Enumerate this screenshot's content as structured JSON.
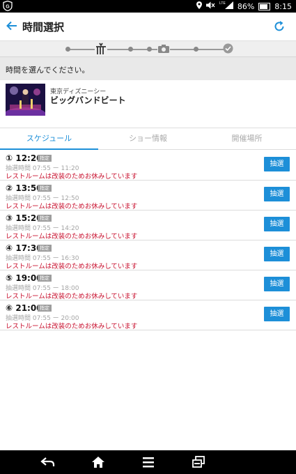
{
  "status_bar": {
    "battery": "86%",
    "time": "8:15",
    "network": "LTE"
  },
  "app_bar": {
    "title": "時間選択",
    "back_icon": "arrow-left-icon",
    "refresh_icon": "refresh-icon"
  },
  "notice": "時間を選んでください。",
  "show": {
    "location": "東京ディズニーシー",
    "name": "ビッグバンドビート"
  },
  "tabs": [
    {
      "label": "スケジュール",
      "active": true
    },
    {
      "label": "ショー情報",
      "active": false
    },
    {
      "label": "開催場所",
      "active": false
    }
  ],
  "schedule": [
    {
      "time": "① 12:20",
      "badge": "指定",
      "period": "抽選時間 07:55 ー 11:20",
      "warning": "レストルームは改装のためお休みしています",
      "button": "抽選"
    },
    {
      "time": "② 13:50",
      "badge": "指定",
      "period": "抽選時間 07:55 ー 12:50",
      "warning": "レストルームは改装のためお休みしています",
      "button": "抽選"
    },
    {
      "time": "③ 15:20",
      "badge": "指定",
      "period": "抽選時間 07:55 ー 14:20",
      "warning": "レストルームは改装のためお休みしています",
      "button": "抽選"
    },
    {
      "time": "④ 17:30",
      "badge": "指定",
      "period": "抽選時間 07:55 ー 16:30",
      "warning": "レストルームは改装のためお休みしています",
      "button": "抽選"
    },
    {
      "time": "⑤ 19:00",
      "badge": "指定",
      "period": "抽選時間 07:55 ー 18:00",
      "warning": "レストルームは改装のためお休みしています",
      "button": "抽選"
    },
    {
      "time": "⑥ 21:00",
      "badge": "指定",
      "period": "抽選時間 07:55 ー 20:00",
      "warning": "レストルームは改装のためお休みしています",
      "button": "抽選"
    }
  ],
  "colors": {
    "accent": "#1d8fd8",
    "warning": "#c8102e",
    "badge": "#9d9d9d"
  },
  "nav_bar": [
    "back-icon",
    "home-icon",
    "menu-icon",
    "recent-apps-icon"
  ]
}
